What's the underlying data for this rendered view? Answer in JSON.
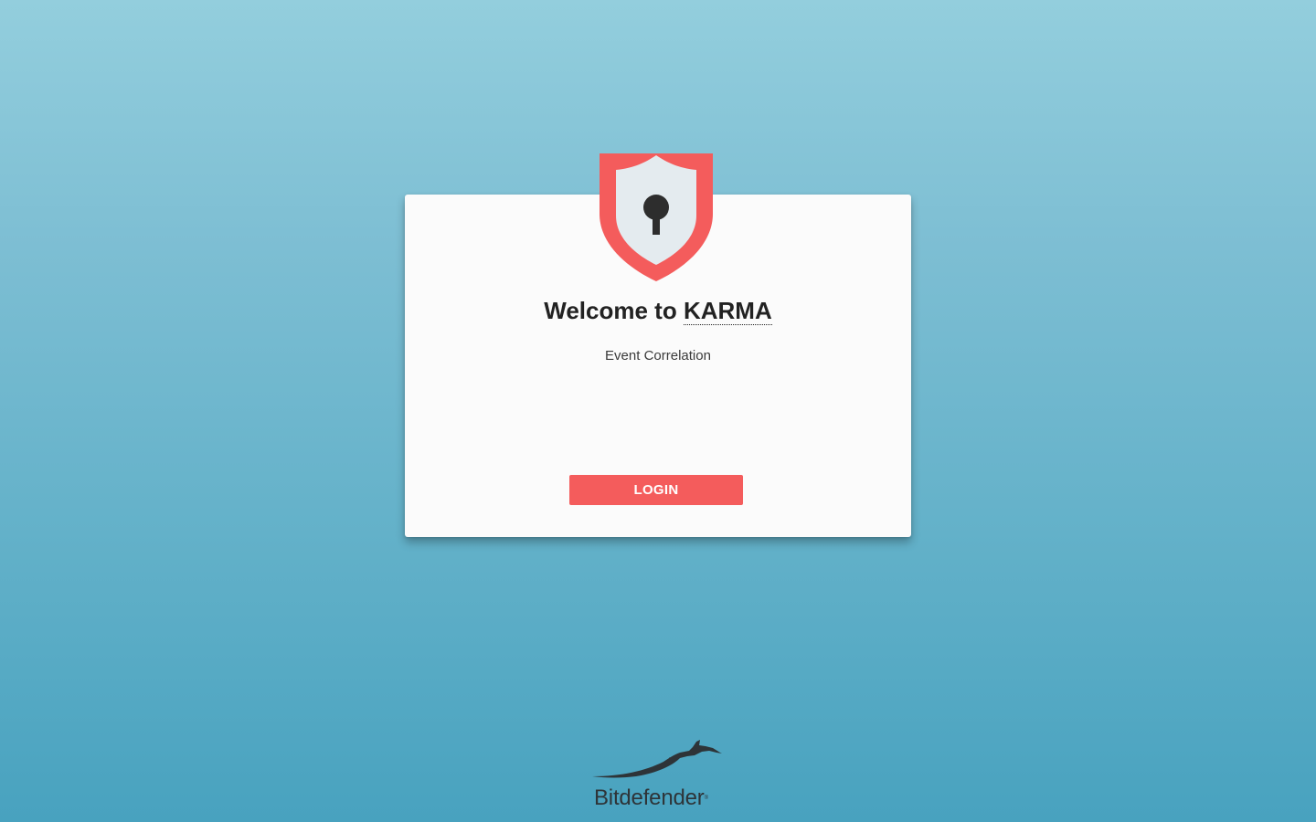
{
  "login": {
    "title_prefix": "Welcome to",
    "product_name": "KARMA",
    "subtitle": "Event Correlation",
    "login_button_label": "LOGIN"
  },
  "footer": {
    "brand_name": "Bitdefender",
    "brand_trademark": "®"
  },
  "icons": {
    "shield": "shield-keyhole-icon",
    "brand_logo": "bitdefender-wolf-logo"
  },
  "colors": {
    "accent": "#f45c5c",
    "card_background": "#fbfbfb",
    "shield_inner": "#e4ebef",
    "keyhole": "#2d2d2d",
    "brand_text": "#2e3438",
    "background_top": "#93cedd",
    "background_bottom": "#48a2bf"
  }
}
